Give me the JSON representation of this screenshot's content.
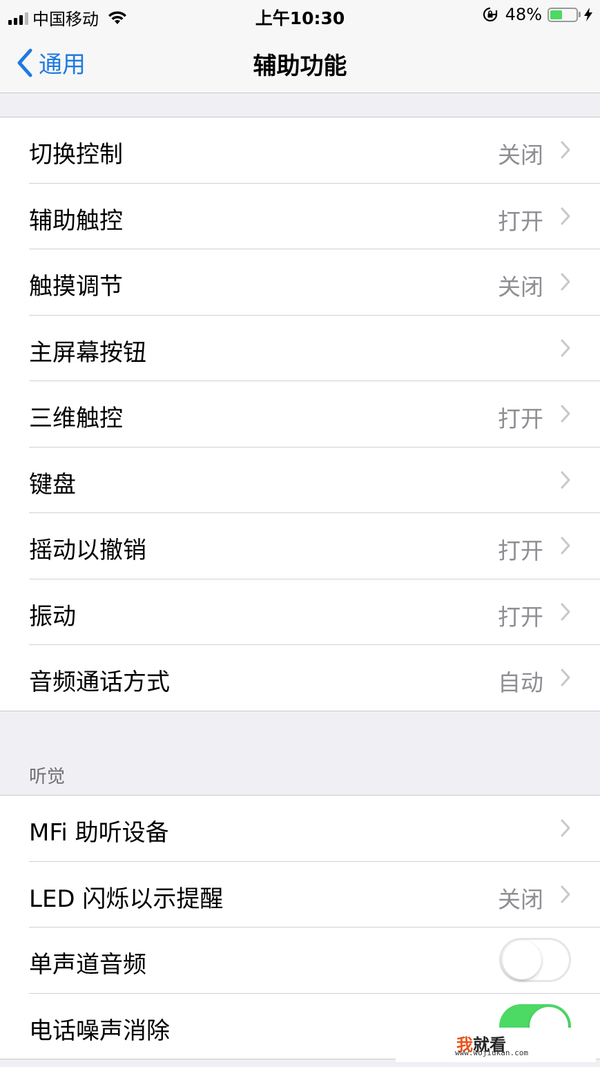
{
  "status_bar": {
    "carrier": "中国移动",
    "time": "上午10:30",
    "battery_percent": "48%",
    "battery_level": 0.48,
    "icons": [
      "signal-icon",
      "wifi-icon",
      "orientation-lock-icon",
      "battery-icon",
      "charging-bolt-icon"
    ]
  },
  "nav": {
    "back_label": "通用",
    "title": "辅助功能"
  },
  "group1": {
    "rows": [
      {
        "label": "切换控制",
        "value": "关闭"
      },
      {
        "label": "辅助触控",
        "value": "打开"
      },
      {
        "label": "触摸调节",
        "value": "关闭"
      },
      {
        "label": "主屏幕按钮",
        "value": ""
      },
      {
        "label": "三维触控",
        "value": "打开"
      },
      {
        "label": "键盘",
        "value": ""
      },
      {
        "label": "摇动以撤销",
        "value": "打开"
      },
      {
        "label": "振动",
        "value": "打开"
      },
      {
        "label": "音频通话方式",
        "value": "自动"
      }
    ]
  },
  "hearing": {
    "header": "听觉",
    "rows": [
      {
        "label": "MFi 助听设备",
        "value": ""
      },
      {
        "label": "LED 闪烁以示提醒",
        "value": "关闭"
      },
      {
        "label": "单声道音频",
        "toggle": "off"
      },
      {
        "label": "电话噪声消除",
        "toggle": "on"
      }
    ]
  },
  "watermark": {
    "logo_first": "我",
    "logo_rest": "就看",
    "url": "www.wojiukan.com"
  },
  "colors": {
    "accent": "#1f7ae0",
    "toggle_on": "#4cd964",
    "background": "#efeff4",
    "secondary_text": "#8e8e93"
  }
}
